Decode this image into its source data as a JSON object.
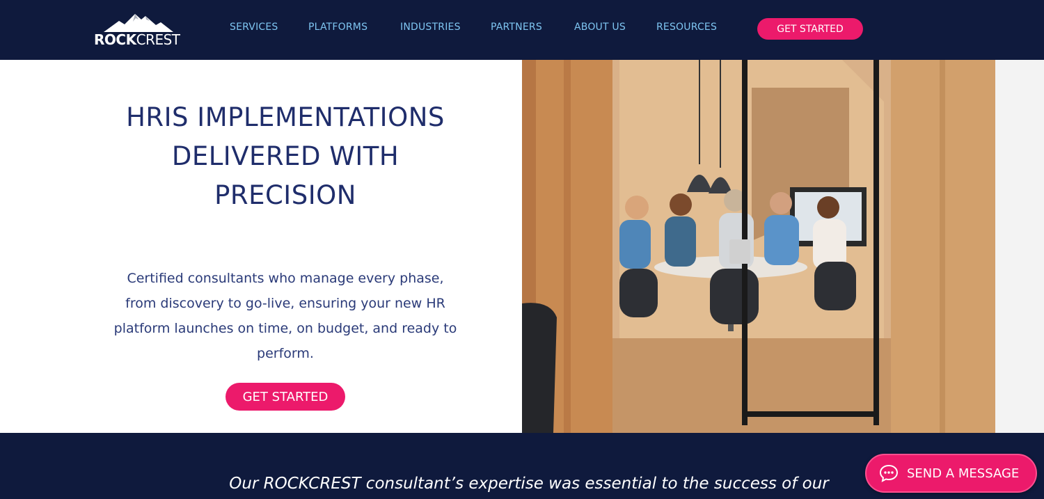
{
  "brand": {
    "logo_bold": "ROCK",
    "logo_light": "CREST",
    "accent_color": "#ec1a6b",
    "navy_color": "#0f1a3d",
    "nav_color": "#7fc6f2"
  },
  "nav": {
    "items": [
      "SERVICES",
      "PLATFORMS",
      "INDUSTRIES",
      "PARTNERS",
      "ABOUT US",
      "RESOURCES"
    ],
    "cta_label": "GET STARTED"
  },
  "hero": {
    "title": "HRIS IMPLEMENTATIONS DELIVERED WITH PRECISION",
    "description": "Certified consultants who manage every phase, from discovery to go-live, ensuring your new HR platform launches on time, on budget, and ready to perform.",
    "cta_label": "GET STARTED",
    "photo_icon": "team-meeting-photo"
  },
  "testimonial": {
    "quote": "Our ROCKCREST consultant’s expertise was essential to the success of our"
  },
  "chat": {
    "label": "SEND A MESSAGE",
    "icon": "chat-bubble-icon"
  }
}
